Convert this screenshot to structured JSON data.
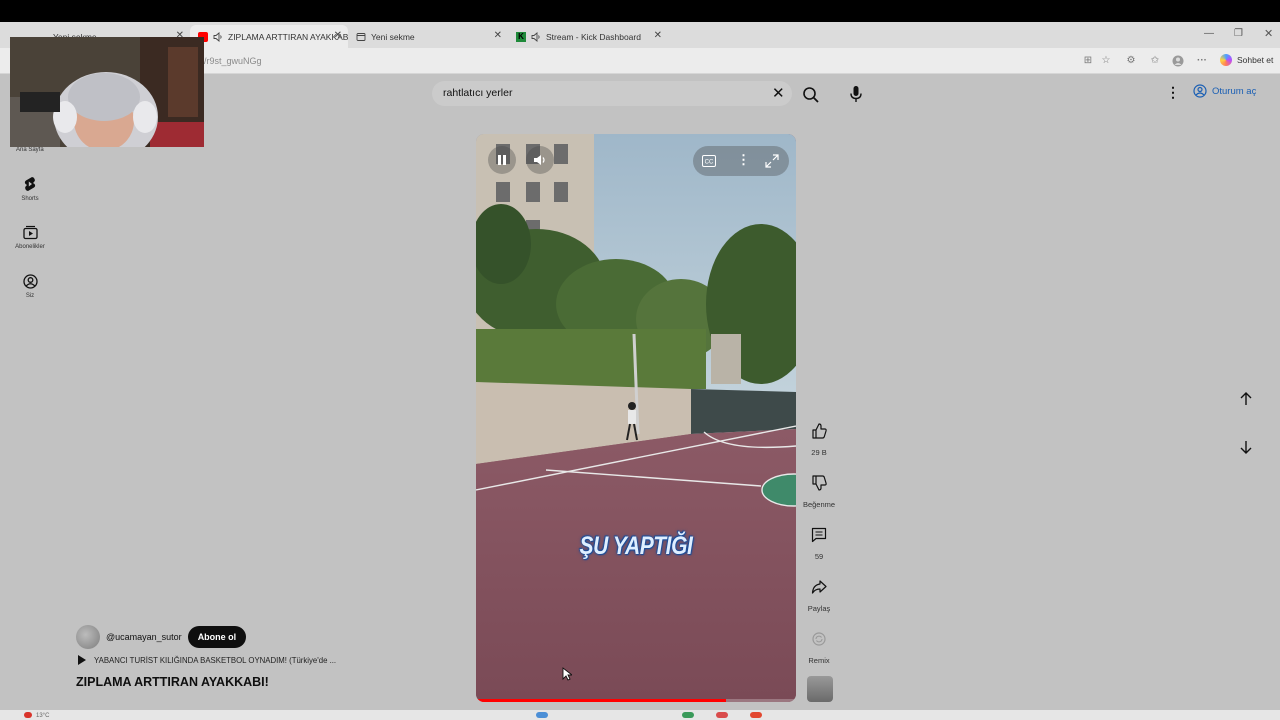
{
  "browser": {
    "tabs": [
      {
        "title": "Yeni sekme",
        "active": false
      },
      {
        "title": "ZIPLAMA ARTTIRAN AYAKKABI",
        "active": true
      },
      {
        "title": "Yeni sekme",
        "active": false
      },
      {
        "title": "Stream - Kick Dashboard",
        "active": false
      }
    ],
    "url": "/r9st_gwuNGg",
    "chat_label": "Sohbet et"
  },
  "header": {
    "search_value": "rahtlatıcı yerler",
    "signin_label": "Oturum aç"
  },
  "sidebar": {
    "items": [
      {
        "label": "Ana Sayfa",
        "icon": "home-icon"
      },
      {
        "label": "Shorts",
        "icon": "shorts-icon"
      },
      {
        "label": "Abonelikler",
        "icon": "subscriptions-icon"
      },
      {
        "label": "Siz",
        "icon": "account-icon"
      }
    ]
  },
  "video": {
    "caption": "ŞU YAPTIĞI",
    "progress_fraction": 0.78
  },
  "actions": {
    "like_count": "29 B",
    "dislike_label": "Beğenme",
    "comments_count": "59",
    "share_label": "Paylaş",
    "remix_label": "Remix"
  },
  "short_info": {
    "channel": "@ucamayan_sutor",
    "subscribe_label": "Abone ol",
    "related_title": "YABANCI TURİST KILIĞINDA BASKETBOL OYNADIM! (Türkiye'de ...",
    "title": "ZIPLAMA ARTTIRAN AYAKKABI!"
  },
  "taskbar": {
    "left_text": "13°C"
  },
  "colors": {
    "page_bg": "#c2c2c2",
    "accent_blue": "#1a5fb4",
    "progress_red": "#ff0000",
    "court": "#8b5a63"
  }
}
